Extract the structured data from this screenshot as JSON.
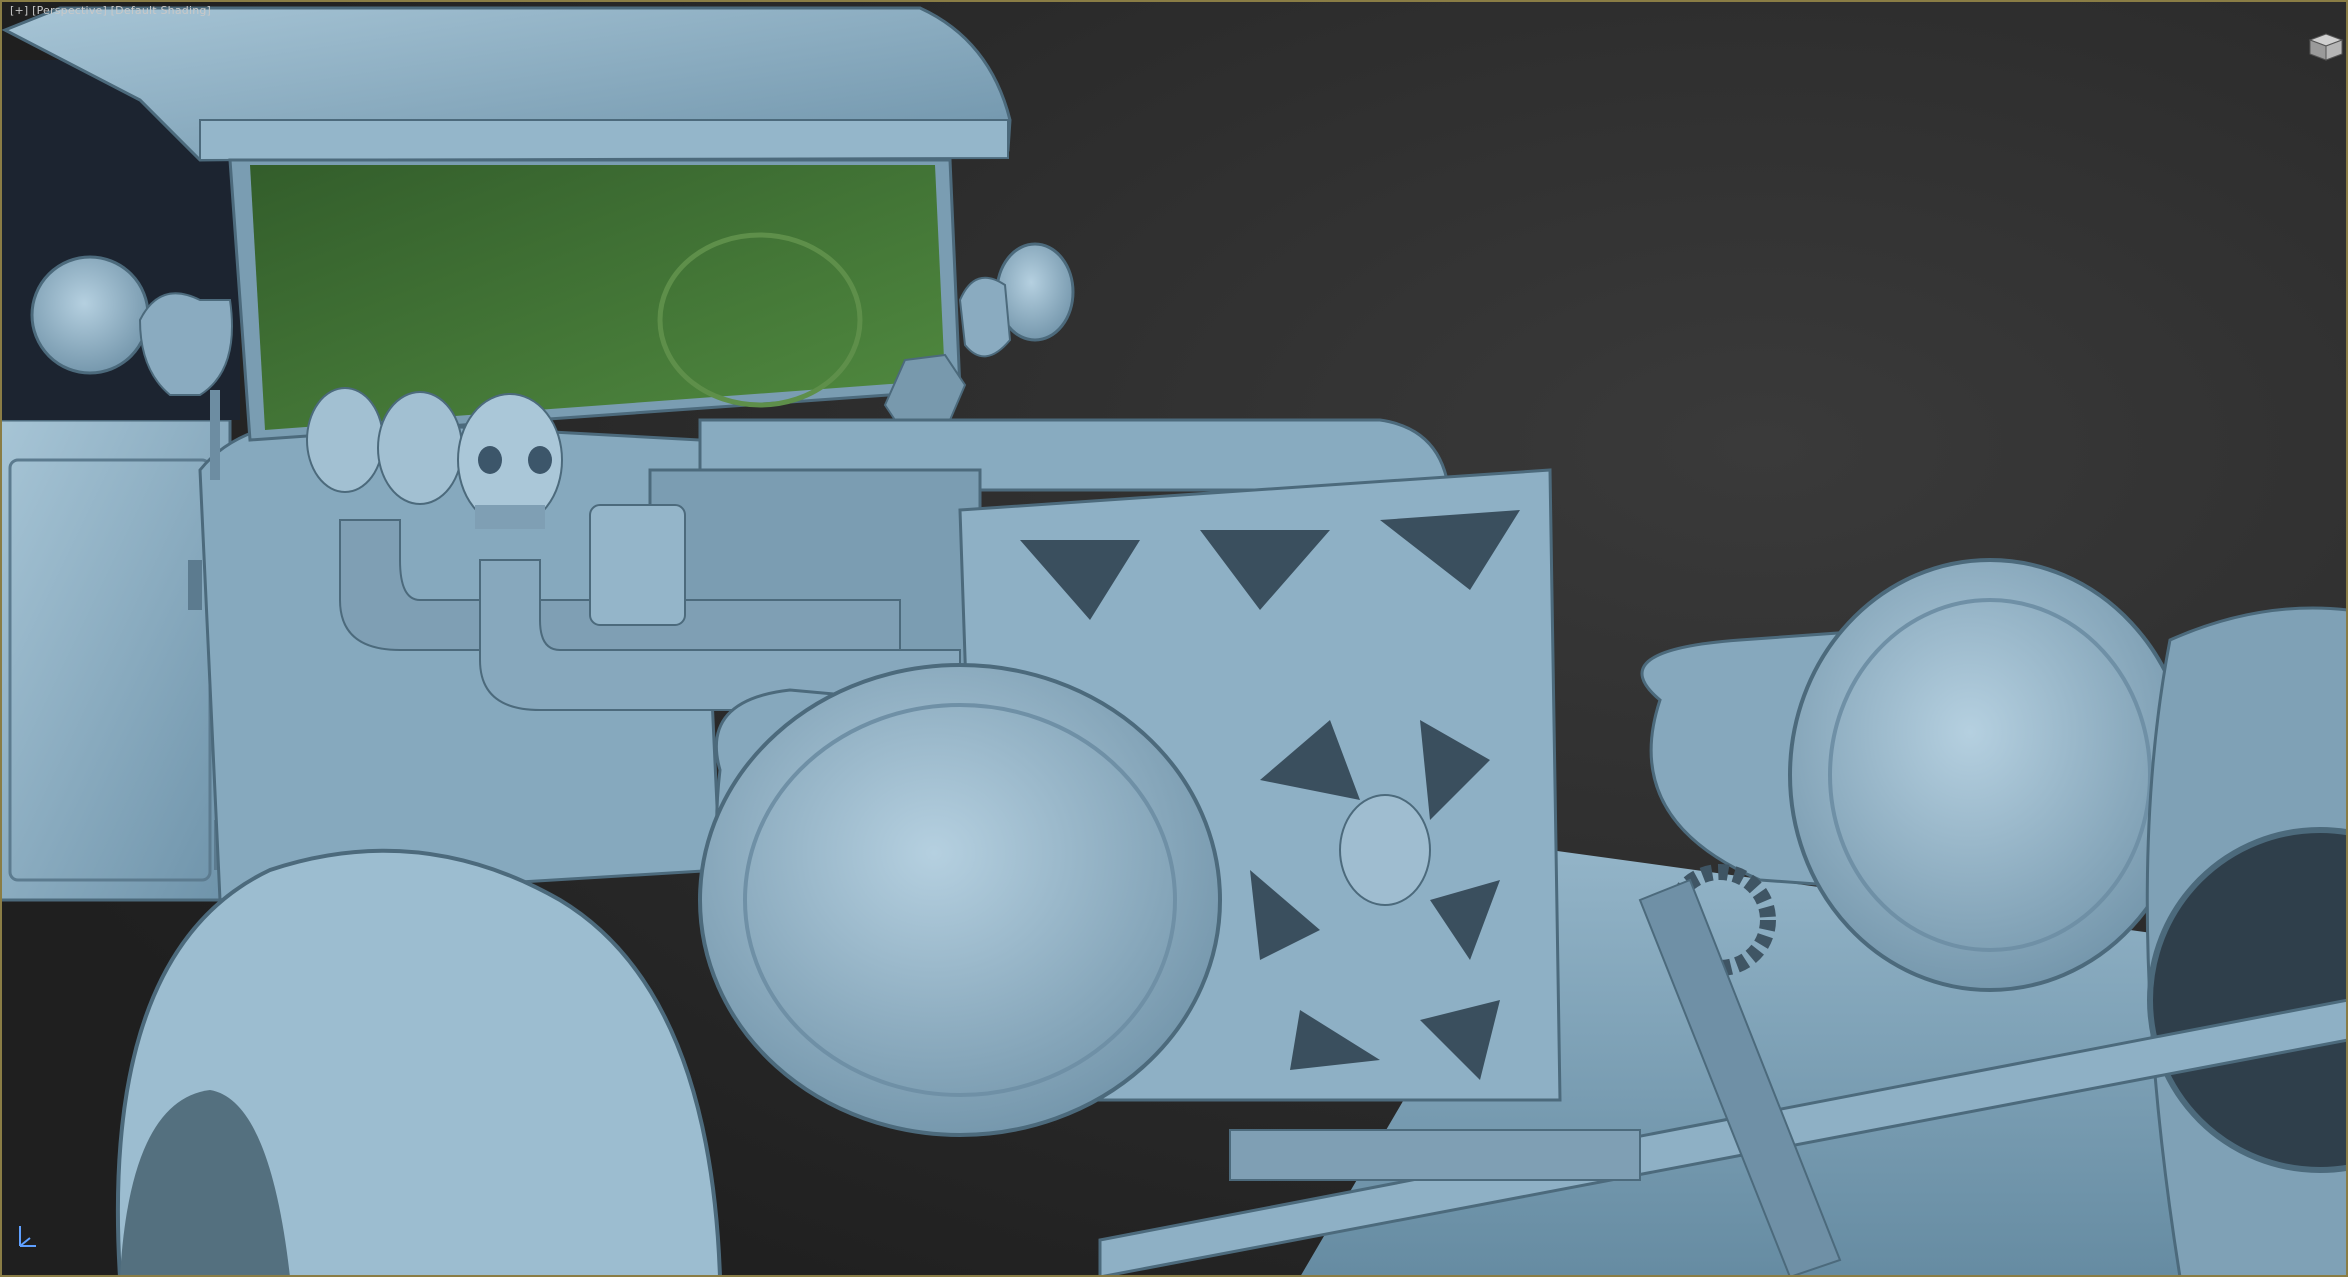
{
  "viewport": {
    "label": "[+] [Perspective] [Default Shading]",
    "status": "",
    "background_color": "#2a2a2a",
    "border_color": "#8a7d45",
    "model_color": "#8fb3c9",
    "glass_color": "#3a6b2a"
  },
  "icons": {
    "viewcube": "viewcube-icon",
    "axis": "axis-tripod-icon"
  }
}
